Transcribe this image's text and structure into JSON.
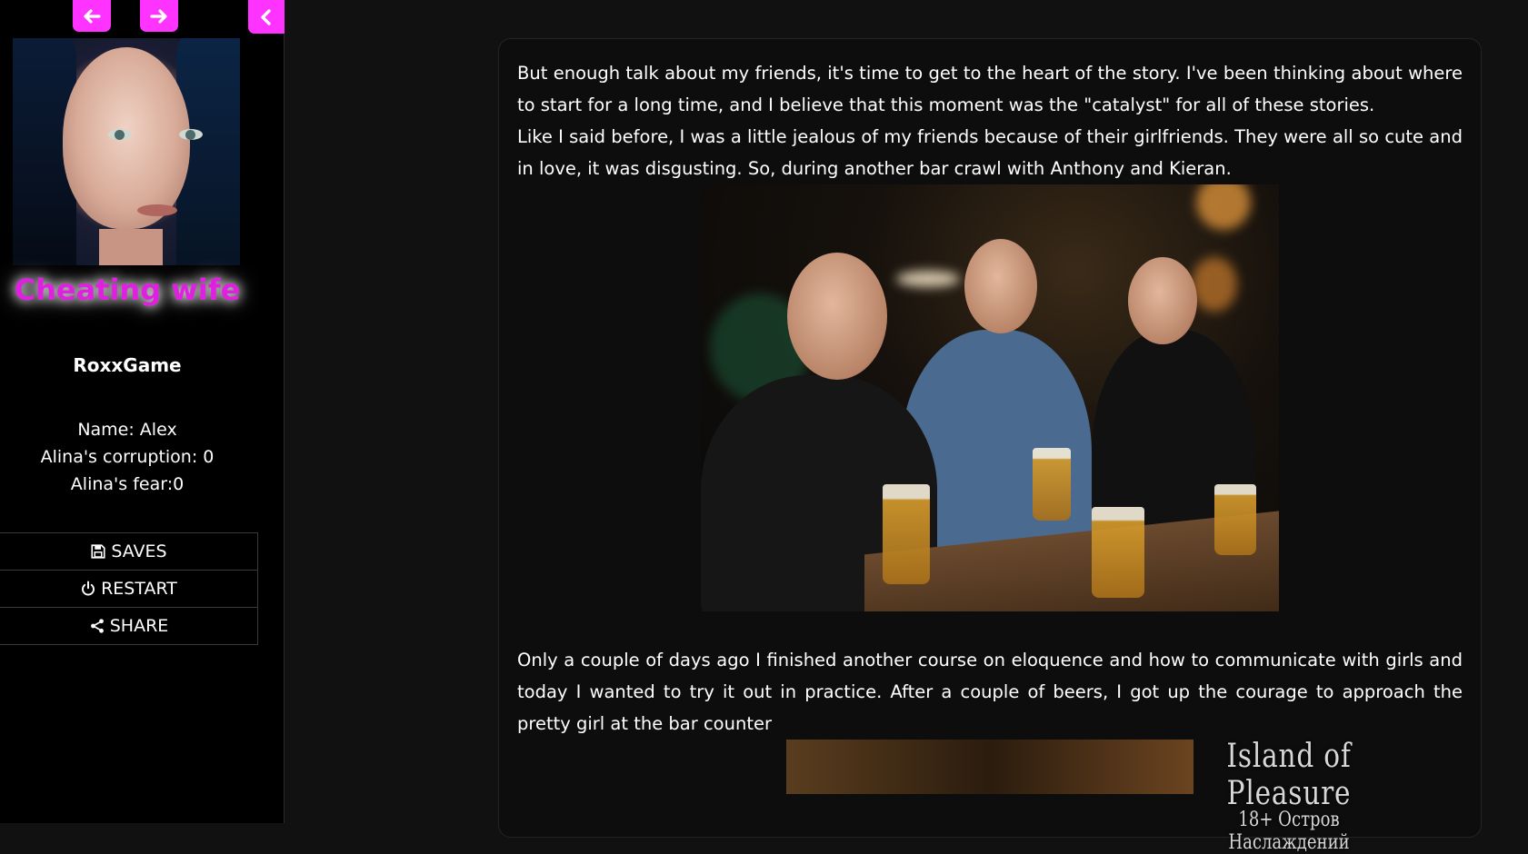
{
  "sidebar": {
    "title": "Cheating wife",
    "author": "RoxxGame",
    "stats": {
      "name": "Name: Alex",
      "corruption": "Alina's corruption: 0",
      "fear": "Alina's fear:0"
    },
    "menu": [
      {
        "label": "SAVES",
        "icon": "floppy-disk-icon"
      },
      {
        "label": "RESTART",
        "icon": "power-icon"
      },
      {
        "label": "SHARE",
        "icon": "share-icon"
      }
    ],
    "nav_icons": [
      "arrow-left-icon",
      "arrow-right-icon",
      "chevron-left-icon"
    ]
  },
  "story": {
    "paragraphs": [
      "But enough talk about my friends, it's time to get to the heart of the story. I've been thinking about where to start for a long time, and I believe that this moment was the \"catalyst\" for all of these stories.",
      "Like I said before, I was a little jealous of my friends because of their girlfriends. They were all so cute and in love, it was disgusting. So, during another bar crawl with Anthony and Kieran.",
      "Only a couple of days ago I finished another course on eloquence and how to communicate with girls and today I wanted to try it out in practice. After a couple of beers, I got up the courage to approach the pretty girl at the bar counter"
    ]
  },
  "watermark": {
    "title": "Island of Pleasure",
    "subtitle": "18+ Остров Наслаждений"
  },
  "colors": {
    "accent": "#ff33ff",
    "title": "#e020e0",
    "background": "#111111",
    "sidebar": "#000000"
  }
}
